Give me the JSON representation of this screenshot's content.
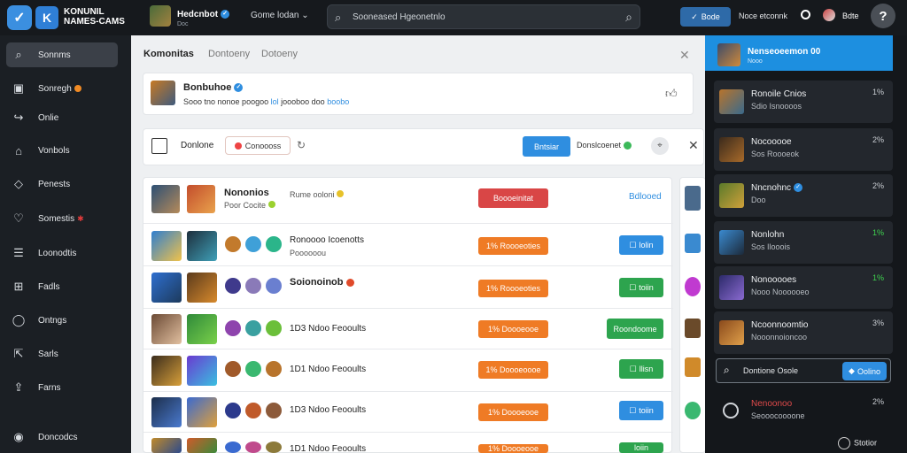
{
  "topbar": {
    "brand_line1": "KONUNIL",
    "brand_line2": "NAMES-CAMS",
    "user_name": "Hedcnbot",
    "user_sub": "Doc",
    "dropdown_label": "Gome lodan",
    "search_placeholder": "Sooneased Hgeonetnlo",
    "primary_button": "Bode",
    "status_text": "Noce etconnk",
    "user2_name": "Bdte",
    "help_label": "?"
  },
  "sidebar": {
    "items": [
      {
        "label": "Sonnms",
        "icon": "search-icon"
      },
      {
        "label": "Sonregh",
        "icon": "monitor-icon"
      },
      {
        "label": "Onlie",
        "icon": "share-icon"
      },
      {
        "label": "Vonbols",
        "icon": "home-icon"
      },
      {
        "label": "Penests",
        "icon": "tag-icon"
      },
      {
        "label": "Somestis",
        "icon": "heart-icon"
      },
      {
        "label": "Loonodtis",
        "icon": "list-icon"
      },
      {
        "label": "Fadls",
        "icon": "grid-icon"
      },
      {
        "label": "Ontngs",
        "icon": "chat-icon"
      },
      {
        "label": "Sarls",
        "icon": "upload-icon"
      },
      {
        "label": "Farns",
        "icon": "export-icon"
      },
      {
        "label": "Doncodcs",
        "icon": "settings-icon"
      }
    ]
  },
  "main": {
    "tabs": [
      "Komonitas",
      "Dontoeny",
      "Dotoeny"
    ],
    "post": {
      "author": "Bonbuhoe",
      "text_a": "Sooo tno nonoe poogoo",
      "text_link": "lol",
      "text_b": "joooboo doo",
      "text_tag": "boobo"
    },
    "filter": {
      "title": "Donlone",
      "badge": "Conoooss",
      "primary": "Bntsiar",
      "status": "Donslcoenet"
    },
    "rows": [
      {
        "title": "Nononios",
        "sub": "Poor Cocite",
        "meta": "Rume ooloni",
        "action": "Boooeinitat",
        "action_color": "red",
        "right": "Bdlooed",
        "right_type": "text"
      },
      {
        "title": "Ronoooo Icoenotts",
        "sub": "Poooooou",
        "meta": "",
        "action": "1% Roooeoties",
        "action_color": "orange",
        "right": "lolin",
        "right_type": "blue"
      },
      {
        "title": "Soionoinob",
        "sub": "",
        "meta": "",
        "action": "1% Roooeoties",
        "action_color": "orange",
        "right": "toiin",
        "right_type": "green"
      },
      {
        "title": "1D3 Ndoo Feooults",
        "sub": "",
        "meta": "",
        "action": "1% Doooeooe",
        "action_color": "orange",
        "right": "Roondoome",
        "right_type": "green"
      },
      {
        "title": "1D1 Ndoo Feooults",
        "sub": "",
        "meta": "",
        "action": "1% Doooeoooe",
        "action_color": "orange",
        "right": "llisn",
        "right_type": "green"
      },
      {
        "title": "1D3 Ndoo Feooults",
        "sub": "",
        "meta": "",
        "action": "1% Doooeooe",
        "action_color": "orange",
        "right": "toiin",
        "right_type": "blue"
      },
      {
        "title": "1D1 Ndoo Feooults",
        "sub": "",
        "meta": "",
        "action": "1% Doooeooe",
        "action_color": "orange",
        "right": "loiin",
        "right_type": "green"
      }
    ]
  },
  "right_panel": {
    "header_title": "Nenseoeemon 00",
    "header_sub": "Nooo",
    "cards": [
      {
        "title": "Ronoile Cnios",
        "sub": "Sdio Isnoooos",
        "val": "1%",
        "val_color": "#c9cdd2"
      },
      {
        "title": "Nocooooe",
        "sub": "Sos Roooeok",
        "val": "2%",
        "val_color": "#c9cdd2"
      },
      {
        "title": "Nncnohnc",
        "sub": "Doo",
        "val": "2%",
        "val_color": "#c9cdd2"
      },
      {
        "title": "Nonlohn",
        "sub": "Sos Ilooois",
        "val": "1%",
        "val_color": "#3fd24f"
      },
      {
        "title": "Nonooooes",
        "sub": "Nooo Noooooeo",
        "val": "1%",
        "val_color": "#3fd24f"
      },
      {
        "title": "Ncoonnoomtio",
        "sub": "Nooonnoioncoo",
        "val": "3%",
        "val_color": "#c9cdd2"
      }
    ],
    "search_text": "Dontione Osole",
    "search_button": "Oolino",
    "bottom_title": "Nenoonoo",
    "bottom_sub": "Seooocoooone",
    "bottom_val": "2%",
    "footer_label": "Stotior"
  }
}
